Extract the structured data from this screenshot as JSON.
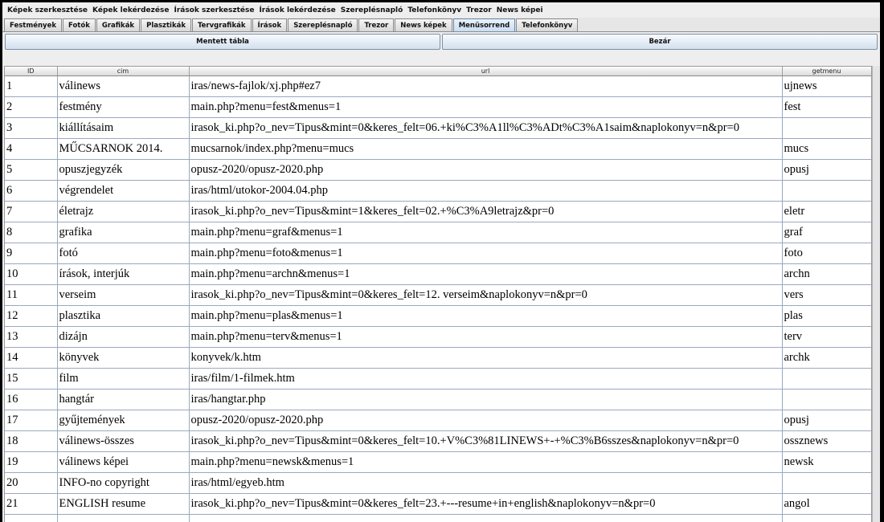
{
  "menu": [
    "Képek szerkesztése",
    "Képek lekérdezése",
    "Írások szerkesztése",
    "Írások lekérdezése",
    "Szereplésnapló",
    "Telefonkönyv",
    "Trezor",
    "News képei"
  ],
  "tabs": [
    {
      "label": "Festmények"
    },
    {
      "label": "Fotók"
    },
    {
      "label": "Grafikák"
    },
    {
      "label": "Plasztikák"
    },
    {
      "label": "Tervgrafikák"
    },
    {
      "label": "Írások"
    },
    {
      "label": "Szereplésnapló"
    },
    {
      "label": "Trezor"
    },
    {
      "label": "News képek"
    },
    {
      "label": "Menüsorrend",
      "active": true
    },
    {
      "label": "Telefonkönyv"
    }
  ],
  "buttons": {
    "save": "Mentett tábla",
    "close": "Bezár"
  },
  "table": {
    "headers": [
      "ID",
      "cim",
      "url",
      "getmenu"
    ],
    "rows": [
      [
        "1",
        "válinews",
        "iras/news-fajlok/xj.php#ez7",
        "ujnews"
      ],
      [
        "2",
        "festmény",
        "main.php?menu=fest&menus=1",
        "fest"
      ],
      [
        "3",
        "kiállításaim",
        "irasok_ki.php?o_nev=Tipus&mint=0&keres_felt=06.+ki%C3%A1ll%C3%ADt%C3%A1saim&naplokonyv=n&pr=0",
        ""
      ],
      [
        "4",
        "MŰCSARNOK 2014.",
        "mucsarnok/index.php?menu=mucs",
        "mucs"
      ],
      [
        "5",
        "opuszjegyzék",
        "opusz-2020/opusz-2020.php",
        "opusj"
      ],
      [
        "6",
        "végrendelet",
        "iras/html/utokor-2004.04.php",
        ""
      ],
      [
        "7",
        "életrajz",
        "irasok_ki.php?o_nev=Tipus&mint=1&keres_felt=02.+%C3%A9letrajz&pr=0",
        "eletr"
      ],
      [
        "8",
        "grafika",
        "main.php?menu=graf&menus=1",
        "graf"
      ],
      [
        "9",
        "fotó",
        "main.php?menu=foto&menus=1",
        "foto"
      ],
      [
        "10",
        "írások, interjúk",
        "main.php?menu=archn&menus=1",
        "archn"
      ],
      [
        "11",
        "verseim",
        "irasok_ki.php?o_nev=Tipus&mint=0&keres_felt=12. verseim&naplokonyv=n&pr=0",
        "vers"
      ],
      [
        "12",
        "plasztika",
        "main.php?menu=plas&menus=1",
        "plas"
      ],
      [
        "13",
        "dizájn",
        "main.php?menu=terv&menus=1",
        "terv"
      ],
      [
        "14",
        "könyvek",
        "konyvek/k.htm",
        "archk"
      ],
      [
        "15",
        "film",
        "iras/film/1-filmek.htm",
        ""
      ],
      [
        "16",
        "hangtár",
        "iras/hangtar.php",
        ""
      ],
      [
        "17",
        "gyűjtemények",
        "opusz-2020/opusz-2020.php",
        "opusj"
      ],
      [
        "18",
        "válinews-összes",
        "irasok_ki.php?o_nev=Tipus&mint=0&keres_felt=10.+V%C3%81LINEWS+-+%C3%B6sszes&naplokonyv=n&pr=0",
        "ossznews"
      ],
      [
        "19",
        "válinews képei",
        "main.php?menu=newsk&menus=1",
        "newsk"
      ],
      [
        "20",
        "INFO-no copyright",
        "iras/html/egyeb.htm",
        ""
      ],
      [
        "21",
        "ENGLISH resume",
        "irasok_ki.php?o_nev=Tipus&mint=0&keres_felt=23.+---resume+in+english&naplokonyv=n&pr=0",
        "angol"
      ]
    ]
  }
}
